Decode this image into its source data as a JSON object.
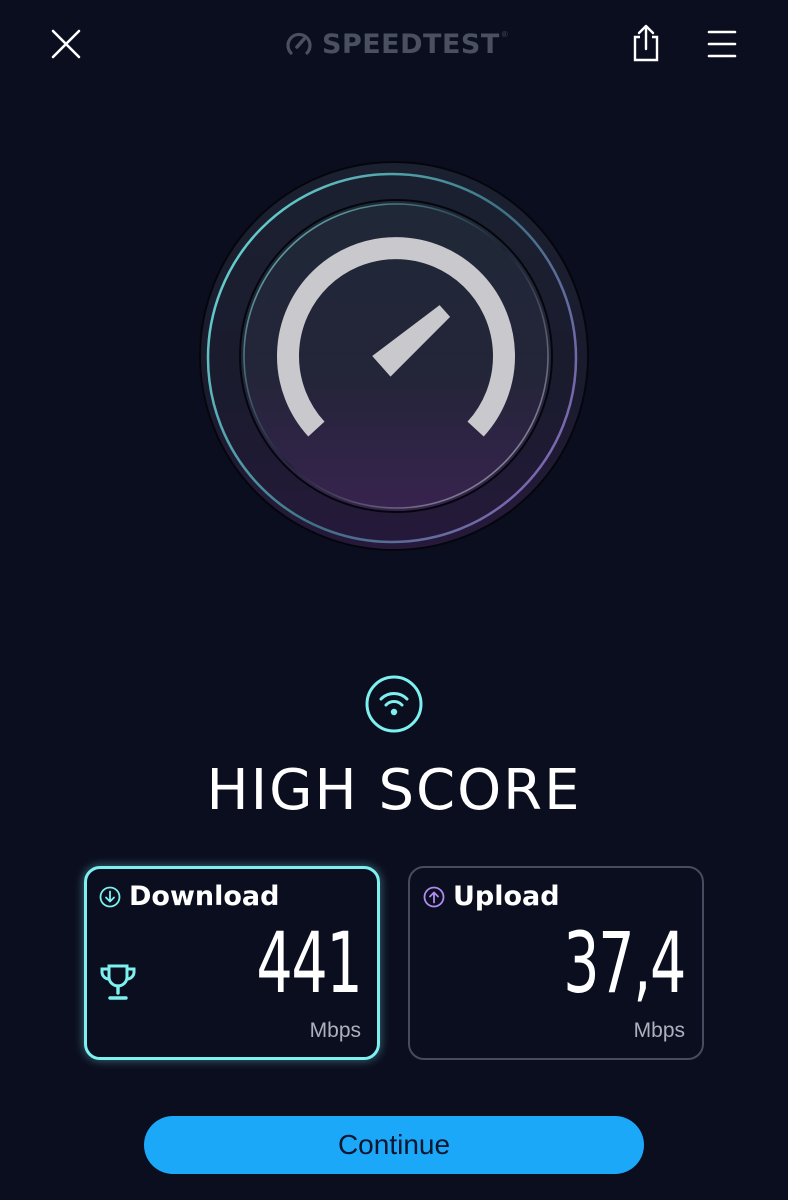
{
  "header": {
    "logo_text": "SPEEDTEST",
    "logo_mark": "®",
    "close_icon": "close-icon",
    "share_icon": "share-icon",
    "menu_icon": "hamburger-menu-icon"
  },
  "gauge": {
    "icon": "speedometer-icon"
  },
  "result": {
    "connection_icon": "wifi-icon",
    "title": "HIGH SCORE"
  },
  "download": {
    "label": "Download",
    "value": "441",
    "unit": "Mbps",
    "direction_icon": "arrow-down-circle-icon",
    "award_icon": "trophy-icon"
  },
  "upload": {
    "label": "Upload",
    "value": "37,4",
    "unit": "Mbps",
    "direction_icon": "arrow-up-circle-icon"
  },
  "continue_label": "Continue",
  "colors": {
    "background": "#0b0e1f",
    "download_accent": "#7ef0f0",
    "upload_accent": "#b08cf0",
    "button": "#1ca8f8"
  }
}
